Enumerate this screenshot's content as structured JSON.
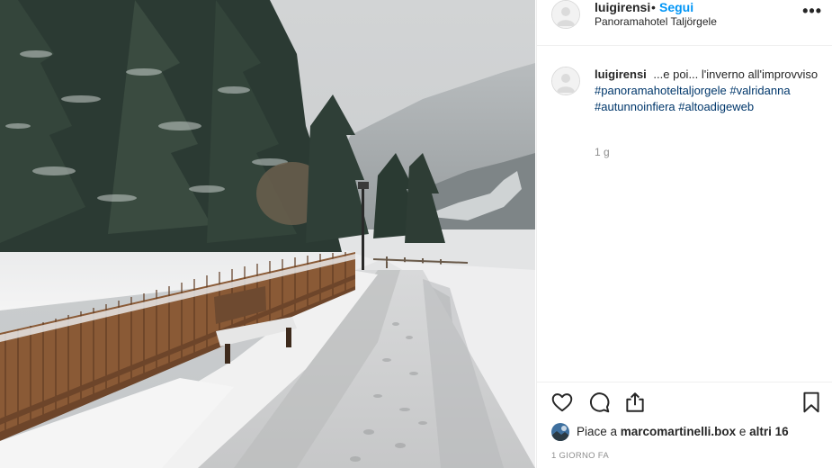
{
  "post": {
    "author": "luigirensi",
    "separator": "•",
    "follow_label": "Segui",
    "location": "Panoramahotel Taljörgele",
    "more_label": "•••"
  },
  "caption": {
    "author": "luigirensi",
    "text": "...e poi... l'inverno all'improvviso",
    "hashtags": [
      "#panoramahoteltaljorgele",
      "#valridanna",
      "#autunnoinfiera",
      "#altoadigeweb"
    ],
    "time_ago": "1 g"
  },
  "actions": {
    "like_icon": "heart-icon",
    "comment_icon": "speech-bubble-icon",
    "share_icon": "share-icon",
    "save_icon": "bookmark-icon"
  },
  "likes": {
    "prefix": "Piace a ",
    "user": "marcomartinelli.box",
    "middle": " e ",
    "others": "altri 16"
  },
  "date_label": "1 GIORNO FA",
  "colors": {
    "link_blue": "#0095f6",
    "hashtag_blue": "#00376b",
    "muted_gray": "#8e8e8e",
    "text": "#262626",
    "divider": "#efefef"
  }
}
